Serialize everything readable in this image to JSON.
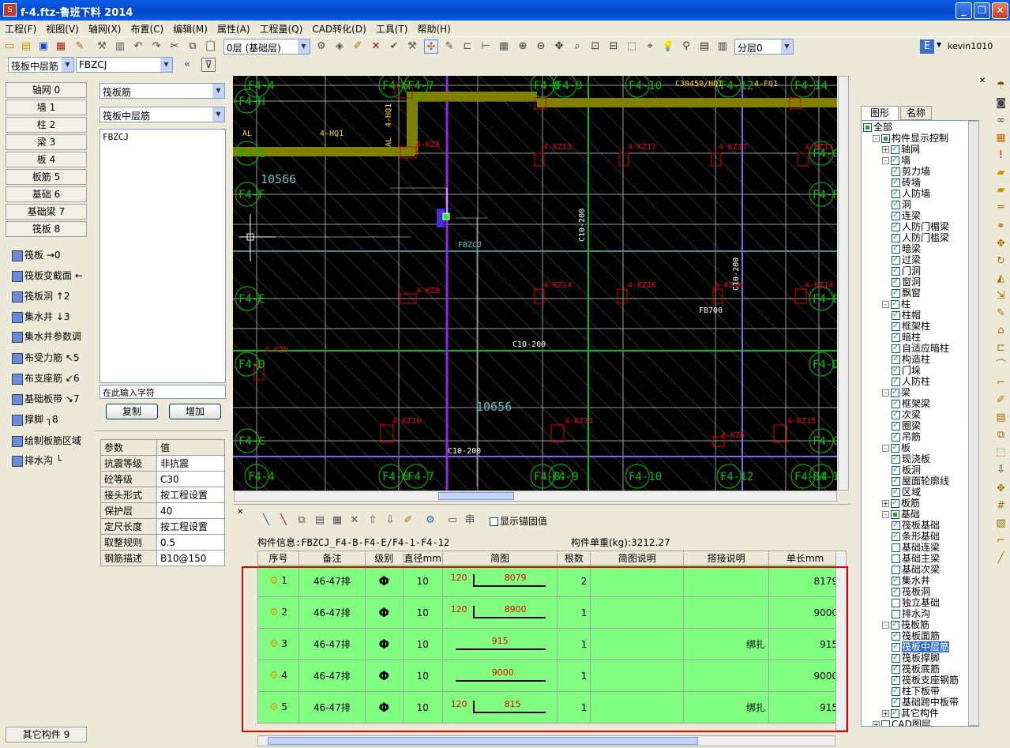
{
  "window": {
    "title": "f-4.ftz-鲁班下料 2014"
  },
  "menu": [
    "工程(F)",
    "视图(V)",
    "轴网(X)",
    "布置(C)",
    "编辑(M)",
    "属性(A)",
    "工程量(Q)",
    "CAD转化(D)",
    "工具(T)",
    "帮助(H)"
  ],
  "toolbar": {
    "layer_select": "0层 (基础层)",
    "sublayer_select": "分层0",
    "user": "kevin1010"
  },
  "toolbar2": {
    "type_select": "筏板中层筋",
    "name_select": "FBZCJ"
  },
  "categories": [
    {
      "label": "轴网",
      "key": "0"
    },
    {
      "label": "墙",
      "key": "1"
    },
    {
      "label": "柱",
      "key": "2"
    },
    {
      "label": "梁",
      "key": "3"
    },
    {
      "label": "板",
      "key": "4"
    },
    {
      "label": "板筋",
      "key": "5"
    },
    {
      "label": "基础",
      "key": "6"
    },
    {
      "label": "基础梁",
      "key": "7"
    },
    {
      "label": "筏板",
      "key": "8"
    }
  ],
  "raft_items": [
    {
      "label": "筏板",
      "key": "→0"
    },
    {
      "label": "筏板变截面",
      "key": "←"
    },
    {
      "label": "筏板洞",
      "key": "↑2"
    },
    {
      "label": "集水井",
      "key": "↓3"
    },
    {
      "label": "集水井参数调",
      "key": ""
    },
    {
      "label": "布受力筋",
      "key": "↖5"
    },
    {
      "label": "布支座筋",
      "key": "↙6"
    },
    {
      "label": "基础板带",
      "key": "↘7"
    },
    {
      "label": "撑脚",
      "key": "┐8"
    },
    {
      "label": "绘制板筋区域",
      "key": ""
    },
    {
      "label": "排水沟",
      "key": "└"
    }
  ],
  "other": {
    "label": "其它构件",
    "key": "9"
  },
  "mid": {
    "select1": "筏板筋",
    "select2": "筏板中层筋",
    "list_items": [
      "FBZCJ"
    ],
    "input_placeholder": "在此输入字符",
    "copy_label": "复制",
    "add_label": "增加",
    "params_header": [
      "参数",
      "值"
    ],
    "params": [
      [
        "抗震等级",
        "非抗震"
      ],
      [
        "砼等级",
        "C30"
      ],
      [
        "接头形式",
        "按工程设置"
      ],
      [
        "保护层",
        "40"
      ],
      [
        "定尺长度",
        "按工程设置"
      ],
      [
        "取整规则",
        "0.5"
      ],
      [
        "钢筋描述",
        "B10@150"
      ]
    ]
  },
  "canvas": {
    "axis_labels": [
      "F4-4",
      "F4-6",
      "F4-7",
      "F4-8",
      "F4-9",
      "F4-10",
      "F4-12",
      "F4-14",
      "F4-H",
      "F4-G",
      "F4-F",
      "F4-E",
      "F4-D",
      "F4-C",
      "F4-1",
      "F4-13"
    ],
    "dims": [
      "10566",
      "10656"
    ],
    "labels": [
      "4-KZ8",
      "4-KZ13",
      "4-KZ17",
      "4-KZ17",
      "4-KZ13",
      "4-KZ9",
      "4-KZ14",
      "4-KZ16",
      "4-KZ16",
      "4-KZ14",
      "4-KZ10",
      "4-KZ15",
      "4-KZ6",
      "4-KZ15",
      "4-KZ9",
      "C10-200",
      "C10-200",
      "C10-200",
      "C10-200",
      "FBZCJ",
      "FB700",
      "4-HQ1",
      "4-HQ1",
      "AL",
      "AL",
      "4-FQ1",
      "C30450/HQI"
    ]
  },
  "rebar": {
    "toolbar_check": "显示锚固值",
    "info_label": "构件信息:FBZCJ_F4-B-F4-E/F4-1-F4-12",
    "weight_label": "构件单重(kg):3212.27",
    "headers": [
      "序号",
      "备注",
      "级别",
      "直径mm",
      "简图",
      "根数",
      "简图说明",
      "搭接说明",
      "单长mm"
    ],
    "rows": [
      {
        "no": "1",
        "note": "46-47排",
        "grade": "⚲",
        "dia": "10",
        "hook": "120",
        "len": "8079",
        "count": "2",
        "desc": "",
        "lap": "",
        "unit": "8179"
      },
      {
        "no": "2",
        "note": "46-47排",
        "grade": "⚲",
        "dia": "10",
        "hook": "120",
        "len": "8900",
        "count": "1",
        "desc": "",
        "lap": "",
        "unit": "9000"
      },
      {
        "no": "3",
        "note": "46-47排",
        "grade": "⚲",
        "dia": "10",
        "hook": "",
        "len": "915",
        "count": "1",
        "desc": "",
        "lap": "绑扎",
        "unit": "915"
      },
      {
        "no": "4",
        "note": "46-47排",
        "grade": "⚲",
        "dia": "10",
        "hook": "",
        "len": "9000",
        "count": "1",
        "desc": "",
        "lap": "",
        "unit": "9000"
      },
      {
        "no": "5",
        "note": "46-47排",
        "grade": "⚲",
        "dia": "10",
        "hook": "120",
        "len": "815",
        "count": "1",
        "desc": "",
        "lap": "绑扎",
        "unit": "915"
      }
    ]
  },
  "right": {
    "tab_graphic": "图形",
    "tab_name": "名称",
    "tree": [
      {
        "label": "全部",
        "level": 0,
        "state": "part",
        "exp": ""
      },
      {
        "label": "构件显示控制",
        "level": 1,
        "state": "part",
        "exp": "-"
      },
      {
        "label": "轴网",
        "level": 2,
        "state": "on",
        "exp": "+"
      },
      {
        "label": "墙",
        "level": 2,
        "state": "on",
        "exp": "-"
      },
      {
        "label": "剪力墙",
        "level": 3,
        "state": "on",
        "exp": ""
      },
      {
        "label": "砖墙",
        "level": 3,
        "state": "on",
        "exp": ""
      },
      {
        "label": "人防墙",
        "level": 3,
        "state": "on",
        "exp": ""
      },
      {
        "label": "洞",
        "level": 3,
        "state": "on",
        "exp": ""
      },
      {
        "label": "连梁",
        "level": 3,
        "state": "on",
        "exp": ""
      },
      {
        "label": "人防门楣梁",
        "level": 3,
        "state": "on",
        "exp": ""
      },
      {
        "label": "人防门槛梁",
        "level": 3,
        "state": "on",
        "exp": ""
      },
      {
        "label": "暗梁",
        "level": 3,
        "state": "on",
        "exp": ""
      },
      {
        "label": "过梁",
        "level": 3,
        "state": "on",
        "exp": ""
      },
      {
        "label": "门洞",
        "level": 3,
        "state": "on",
        "exp": ""
      },
      {
        "label": "窗洞",
        "level": 3,
        "state": "on",
        "exp": ""
      },
      {
        "label": "飘窗",
        "level": 3,
        "state": "on",
        "exp": ""
      },
      {
        "label": "柱",
        "level": 2,
        "state": "on",
        "exp": "-"
      },
      {
        "label": "柱帽",
        "level": 3,
        "state": "on",
        "exp": ""
      },
      {
        "label": "框架柱",
        "level": 3,
        "state": "on",
        "exp": ""
      },
      {
        "label": "暗柱",
        "level": 3,
        "state": "on",
        "exp": ""
      },
      {
        "label": "自适应暗柱",
        "level": 3,
        "state": "on",
        "exp": ""
      },
      {
        "label": "构造柱",
        "level": 3,
        "state": "on",
        "exp": ""
      },
      {
        "label": "门垛",
        "level": 3,
        "state": "on",
        "exp": ""
      },
      {
        "label": "人防柱",
        "level": 3,
        "state": "on",
        "exp": ""
      },
      {
        "label": "梁",
        "level": 2,
        "state": "on",
        "exp": "-"
      },
      {
        "label": "框架梁",
        "level": 3,
        "state": "on",
        "exp": ""
      },
      {
        "label": "次梁",
        "level": 3,
        "state": "on",
        "exp": ""
      },
      {
        "label": "圈梁",
        "level": 3,
        "state": "on",
        "exp": ""
      },
      {
        "label": "吊筋",
        "level": 3,
        "state": "on",
        "exp": ""
      },
      {
        "label": "板",
        "level": 2,
        "state": "on",
        "exp": "-"
      },
      {
        "label": "现浇板",
        "level": 3,
        "state": "on",
        "exp": ""
      },
      {
        "label": "板洞",
        "level": 3,
        "state": "on",
        "exp": ""
      },
      {
        "label": "屋面轮廓线",
        "level": 3,
        "state": "on",
        "exp": ""
      },
      {
        "label": "区域",
        "level": 3,
        "state": "on",
        "exp": ""
      },
      {
        "label": "板筋",
        "level": 2,
        "state": "on",
        "exp": "+"
      },
      {
        "label": "基础",
        "level": 2,
        "state": "part",
        "exp": "-"
      },
      {
        "label": "筏板基础",
        "level": 3,
        "state": "on",
        "exp": ""
      },
      {
        "label": "条形基础",
        "level": 3,
        "state": "on",
        "exp": ""
      },
      {
        "label": "基础连梁",
        "level": 3,
        "state": "off",
        "exp": ""
      },
      {
        "label": "基础主梁",
        "level": 3,
        "state": "off",
        "exp": ""
      },
      {
        "label": "基础次梁",
        "level": 3,
        "state": "off",
        "exp": ""
      },
      {
        "label": "集水井",
        "level": 3,
        "state": "on",
        "exp": ""
      },
      {
        "label": "筏板洞",
        "level": 3,
        "state": "on",
        "exp": ""
      },
      {
        "label": "独立基础",
        "level": 3,
        "state": "off",
        "exp": ""
      },
      {
        "label": "排水沟",
        "level": 3,
        "state": "off",
        "exp": ""
      },
      {
        "label": "筏板筋",
        "level": 2,
        "state": "on",
        "exp": "-"
      },
      {
        "label": "筏板面筋",
        "level": 3,
        "state": "on",
        "exp": ""
      },
      {
        "label": "筏板中层筋",
        "level": 3,
        "state": "on",
        "exp": "",
        "selected": true
      },
      {
        "label": "筏板撑脚",
        "level": 3,
        "state": "on",
        "exp": ""
      },
      {
        "label": "筏板底筋",
        "level": 3,
        "state": "on",
        "exp": ""
      },
      {
        "label": "筏板支座钢筋",
        "level": 3,
        "state": "on",
        "exp": ""
      },
      {
        "label": "柱下板带",
        "level": 3,
        "state": "on",
        "exp": ""
      },
      {
        "label": "基础跨中板带",
        "level": 3,
        "state": "on",
        "exp": ""
      },
      {
        "label": "其它构件",
        "level": 2,
        "state": "on",
        "exp": "+"
      },
      {
        "label": "CAD图层",
        "level": 1,
        "state": "off",
        "exp": "+"
      }
    ]
  }
}
